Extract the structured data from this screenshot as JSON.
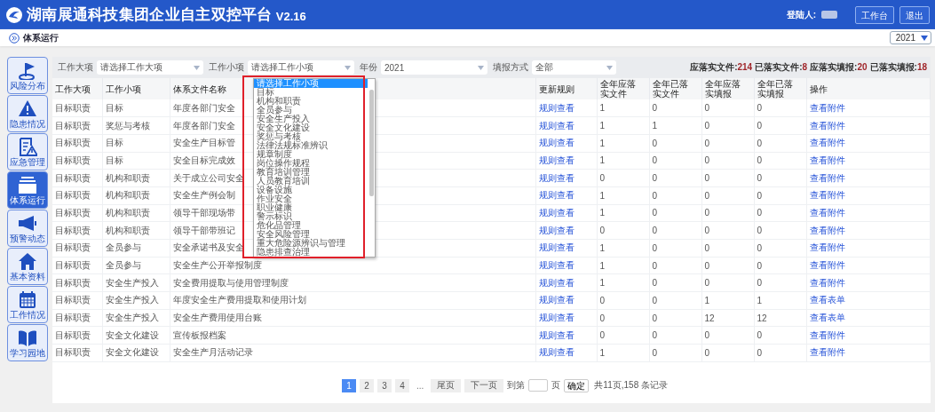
{
  "app": {
    "title": "湖南展通科技集团企业自主双控平台",
    "version": "V2.16",
    "user_label": "登陆人:",
    "buttons": [
      "工作台",
      "退出"
    ]
  },
  "breadcrumb": {
    "label": "体系运行",
    "year": "2021"
  },
  "sidebar": [
    {
      "label": "风险分布",
      "selected": false
    },
    {
      "label": "隐患情况",
      "selected": false
    },
    {
      "label": "应急管理",
      "selected": false
    },
    {
      "label": "体系运行",
      "selected": true
    },
    {
      "label": "预警动态",
      "selected": false
    },
    {
      "label": "基本资料",
      "selected": false
    },
    {
      "label": "工作情况",
      "selected": false
    },
    {
      "label": "学习园地",
      "selected": false
    }
  ],
  "filters": [
    {
      "label": "工作大项",
      "placeholder": "请选择工作大项"
    },
    {
      "label": "工作小项",
      "placeholder": "请选择工作小项",
      "expanded": true
    },
    {
      "label": "年份",
      "value": "2021"
    },
    {
      "label": "填报方式",
      "value": "全部"
    }
  ],
  "stats": [
    {
      "label": "应落实文件:",
      "value": "214"
    },
    {
      "label": "已落实文件:",
      "value": "8"
    },
    {
      "label": "应落实填报:",
      "value": "20"
    },
    {
      "label": "已落实填报:",
      "value": "18"
    }
  ],
  "dropdown": {
    "options": [
      {
        "label": "请选择工作小项",
        "selected": true
      },
      {
        "label": "目标",
        "selected": false
      },
      {
        "label": "机构和职责",
        "selected": false
      },
      {
        "label": "全员参与",
        "selected": false
      },
      {
        "label": "安全生产投入",
        "selected": false
      },
      {
        "label": "安全文化建设",
        "selected": false
      },
      {
        "label": "奖惩与考核",
        "selected": false
      },
      {
        "label": "法律法规标准辨识",
        "selected": false
      },
      {
        "label": "规章制度",
        "selected": false
      },
      {
        "label": "岗位操作规程",
        "selected": false
      },
      {
        "label": "教育培训管理",
        "selected": false
      },
      {
        "label": "人员教育培训",
        "selected": false
      },
      {
        "label": "设备设施",
        "selected": false
      },
      {
        "label": "作业安全",
        "selected": false
      },
      {
        "label": "职业健康",
        "selected": false
      },
      {
        "label": "警示标识",
        "selected": false
      },
      {
        "label": "危化品管理",
        "selected": false
      },
      {
        "label": "安全风险管理",
        "selected": false
      },
      {
        "label": "重大危险源辨识与管理",
        "selected": false
      },
      {
        "label": "隐患排查治理",
        "selected": false
      }
    ],
    "highlight_frame": true
  },
  "table": {
    "columns": [
      "工作大项",
      "工作小项",
      "体系文件名称",
      "更新规则",
      "全年应落实文件",
      "全年已落实文件",
      "全年应落实填报",
      "全年已落实填报",
      "操作"
    ],
    "rows": [
      [
        "目标职责",
        "目标",
        "年度各部门安全",
        "规则查看",
        "1",
        "0",
        "0",
        "0",
        "查看附件"
      ],
      [
        "目标职责",
        "奖惩与考核",
        "年度各部门安全",
        "规则查看",
        "1",
        "1",
        "0",
        "0",
        "查看附件"
      ],
      [
        "目标职责",
        "目标",
        "安全生产目标管",
        "规则查看",
        "1",
        "0",
        "0",
        "0",
        "查看附件"
      ],
      [
        "目标职责",
        "目标",
        "安全目标完成效",
        "规则查看",
        "1",
        "0",
        "0",
        "0",
        "查看附件"
      ],
      [
        "目标职责",
        "机构和职责",
        "关于成立公司安全",
        "规则查看",
        "0",
        "0",
        "0",
        "0",
        "查看附件"
      ],
      [
        "目标职责",
        "机构和职责",
        "安全生产例会制",
        "规则查看",
        "1",
        "0",
        "0",
        "0",
        "查看附件"
      ],
      [
        "目标职责",
        "机构和职责",
        "领导干部现场带",
        "规则查看",
        "1",
        "0",
        "0",
        "0",
        "查看附件"
      ],
      [
        "目标职责",
        "机构和职责",
        "领导干部带班记",
        "规则查看",
        "0",
        "0",
        "0",
        "0",
        "查看附件"
      ],
      [
        "目标职责",
        "全员参与",
        "安全承诺书及安全",
        "规则查看",
        "1",
        "0",
        "0",
        "0",
        "查看附件"
      ],
      [
        "目标职责",
        "全员参与",
        "安全生产公开举报制度",
        "规则查看",
        "1",
        "0",
        "0",
        "0",
        "查看附件"
      ],
      [
        "目标职责",
        "安全生产投入",
        "安全费用提取与使用管理制度",
        "规则查看",
        "1",
        "0",
        "0",
        "0",
        "查看附件"
      ],
      [
        "目标职责",
        "安全生产投入",
        "年度安全生产费用提取和使用计划",
        "规则查看",
        "0",
        "0",
        "1",
        "1",
        "查看表单"
      ],
      [
        "目标职责",
        "安全生产投入",
        "安全生产费用使用台账",
        "规则查看",
        "0",
        "0",
        "12",
        "12",
        "查看表单"
      ],
      [
        "目标职责",
        "安全文化建设",
        "宣传板报档案",
        "规则查看",
        "0",
        "0",
        "0",
        "0",
        "查看附件"
      ],
      [
        "目标职责",
        "安全文化建设",
        "安全生产月活动记录",
        "规则查看",
        "1",
        "0",
        "0",
        "0",
        "查看附件"
      ]
    ]
  },
  "pagination": {
    "pages": [
      {
        "label": "1",
        "selected": true
      },
      {
        "label": "2",
        "selected": false
      },
      {
        "label": "3",
        "selected": false
      },
      {
        "label": "4",
        "selected": false
      }
    ],
    "ellipsis": "...",
    "last": "尾页",
    "next": "下一页",
    "goto_label": "到第",
    "page_unit": "页",
    "confirm": "确定",
    "summary": "共11页,158 条记录"
  }
}
